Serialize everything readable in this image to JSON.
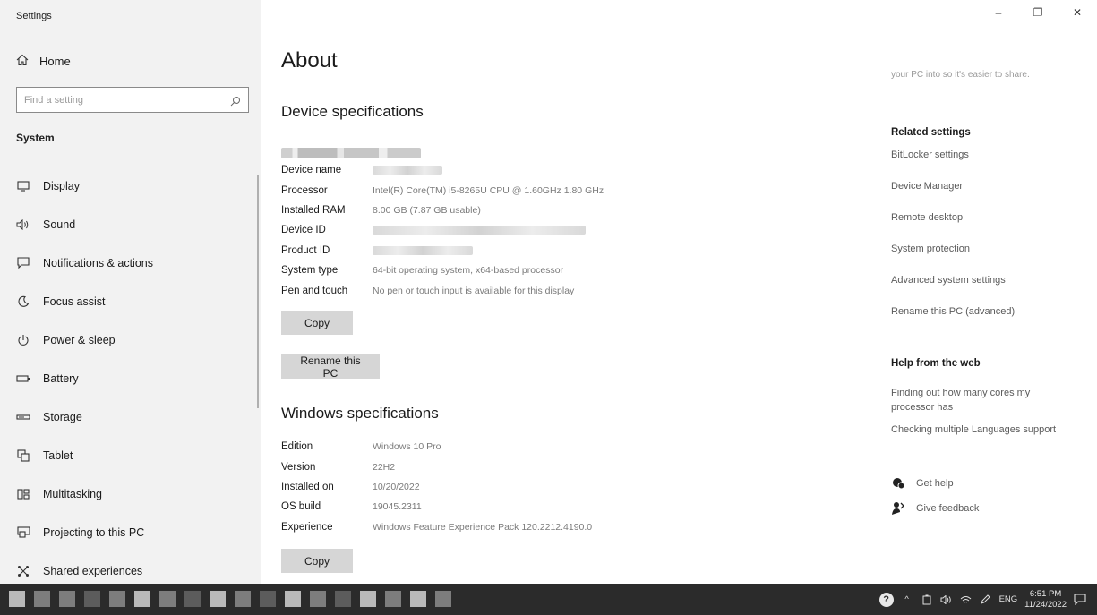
{
  "window": {
    "title": "Settings",
    "controls": {
      "minimize": "–",
      "maximize": "❐",
      "close": "✕"
    }
  },
  "sidebar": {
    "home_label": "Home",
    "search_placeholder": "Find a setting",
    "section": "System",
    "items": [
      {
        "label": "Display",
        "icon": "monitor-icon"
      },
      {
        "label": "Sound",
        "icon": "speaker-icon"
      },
      {
        "label": "Notifications & actions",
        "icon": "notification-icon"
      },
      {
        "label": "Focus assist",
        "icon": "moon-icon"
      },
      {
        "label": "Power & sleep",
        "icon": "power-icon"
      },
      {
        "label": "Battery",
        "icon": "battery-icon"
      },
      {
        "label": "Storage",
        "icon": "storage-icon"
      },
      {
        "label": "Tablet",
        "icon": "tablet-icon"
      },
      {
        "label": "Multitasking",
        "icon": "multitasking-icon"
      },
      {
        "label": "Projecting to this PC",
        "icon": "projecting-icon"
      },
      {
        "label": "Shared experiences",
        "icon": "shared-icon"
      }
    ]
  },
  "main": {
    "title": "About",
    "device_heading": "Device specifications",
    "device_specs": [
      {
        "label": "Device name",
        "value": ""
      },
      {
        "label": "Processor",
        "value": "Intel(R) Core(TM) i5-8265U CPU @ 1.60GHz   1.80 GHz"
      },
      {
        "label": "Installed RAM",
        "value": "8.00 GB (7.87 GB usable)"
      },
      {
        "label": "Device ID",
        "value": ""
      },
      {
        "label": "Product ID",
        "value": ""
      },
      {
        "label": "System type",
        "value": "64-bit operating system, x64-based processor"
      },
      {
        "label": "Pen and touch",
        "value": "No pen or touch input is available for this display"
      }
    ],
    "copy_label": "Copy",
    "rename_label": "Rename this PC",
    "windows_heading": "Windows specifications",
    "windows_specs": [
      {
        "label": "Edition",
        "value": "Windows 10 Pro"
      },
      {
        "label": "Version",
        "value": "22H2"
      },
      {
        "label": "Installed on",
        "value": "10/20/2022"
      },
      {
        "label": "OS build",
        "value": "19045.2311"
      },
      {
        "label": "Experience",
        "value": "Windows Feature Experience Pack 120.2212.4190.0"
      }
    ],
    "copy2_label": "Copy"
  },
  "right": {
    "top_snippet": "your PC into so it's easier to share.",
    "related_heading": "Related settings",
    "related_links": [
      "BitLocker settings",
      "Device Manager",
      "Remote desktop",
      "System protection",
      "Advanced system settings",
      "Rename this PC (advanced)"
    ],
    "help_heading": "Help from the web",
    "help_links": [
      "Finding out how many cores my processor has",
      "Checking multiple Languages support"
    ],
    "get_help": "Get help",
    "give_feedback": "Give feedback"
  },
  "taskbar": {
    "lang": "ENG",
    "time": "6:51 PM",
    "date": "11/24/2022"
  }
}
